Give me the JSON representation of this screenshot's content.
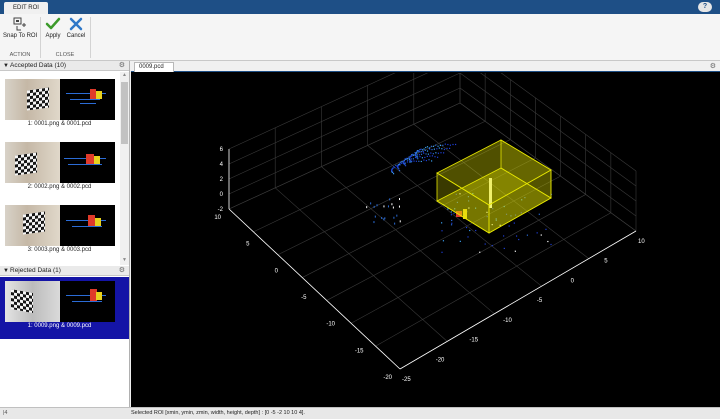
{
  "titlebar": {
    "tab_label": "EDIT ROI",
    "help_label": "?"
  },
  "toolstrip": {
    "snap_label": "Snap To ROI",
    "apply_label": "Apply",
    "cancel_label": "Cancel",
    "section_action": "ACTION",
    "section_close": "CLOSE"
  },
  "accepted": {
    "header": "Accepted Data (10)",
    "items": [
      {
        "caption": "1: 0001.png & 0001.pcd"
      },
      {
        "caption": "2: 0002.png & 0002.pcd"
      },
      {
        "caption": "3: 0003.png & 0003.pcd"
      }
    ]
  },
  "rejected": {
    "header": "Rejected Data (1)",
    "items": [
      {
        "caption": "1: 0009.png & 0009.pcd"
      }
    ]
  },
  "document": {
    "tab_label": "0009.pcd"
  },
  "plot": {
    "z_ticks": [
      "6",
      "4",
      "2",
      "0",
      "-2"
    ],
    "x_ticks": [
      "10",
      "5",
      "0",
      "-5",
      "-10",
      "-15",
      "-20"
    ],
    "y_ticks": [
      "-25",
      "-20",
      "-15",
      "-10",
      "-5",
      "0",
      "5",
      "10"
    ],
    "roi_color": "#e6e600",
    "axis_color": "#ffffff",
    "grid_color": "#3a3a3a"
  },
  "statusbar": {
    "left_label": "|4",
    "text": "Selected ROI [xmin, ymin, zmin, width, height, depth] : [0 -5 -2 10 10 4]."
  },
  "icons": {
    "snap": "snap-roi-icon",
    "apply": "checkmark-icon",
    "cancel": "cancel-x-icon",
    "gear": "gear-icon",
    "collapse": "collapse-triangle-icon"
  }
}
